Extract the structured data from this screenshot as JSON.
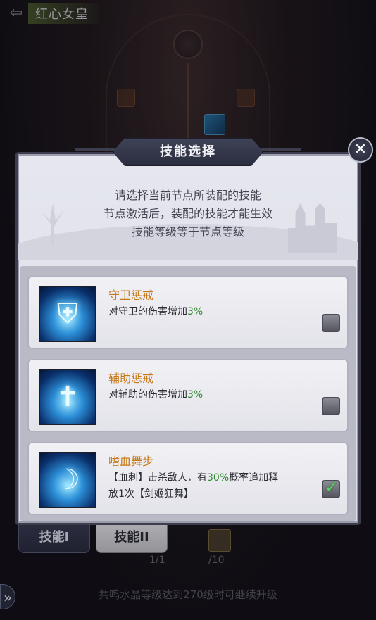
{
  "header": {
    "title": "红心女皇",
    "back_icon": "back-arrow-icon"
  },
  "background": {
    "tabs": [
      {
        "label": "技能I"
      },
      {
        "label": "技能II"
      }
    ],
    "counter_left": "1/1",
    "counter_right": "/10",
    "hint": "共鸣水晶等级达到270级时可继续升级"
  },
  "modal": {
    "title": "技能选择",
    "description": [
      "请选择当前节点所装配的技能",
      "节点激活后，装配的技能才能生效",
      "技能等级等于节点等级"
    ],
    "skills": [
      {
        "name": "守卫惩戒",
        "desc_prefix": "对守卫的伤害增加",
        "desc_value": "3%",
        "desc_suffix": "",
        "desc_line2": "",
        "checked": false,
        "icon": "shield-burst-icon"
      },
      {
        "name": "辅助惩戒",
        "desc_prefix": "对辅助的伤害增加",
        "desc_value": "3%",
        "desc_suffix": "",
        "desc_line2": "",
        "checked": false,
        "icon": "cross-burst-icon"
      },
      {
        "name": "嗜血舞步",
        "desc_prefix": "【血刺】击杀敌人，有",
        "desc_value": "30%",
        "desc_suffix": "概率追加释",
        "desc_line2": "放1次【剑姬狂舞】",
        "checked": true,
        "icon": "dancer-icon"
      }
    ]
  },
  "colors": {
    "skill_name": "#c67a19",
    "highlight": "#2f8a2e",
    "check": "#58d25a"
  }
}
